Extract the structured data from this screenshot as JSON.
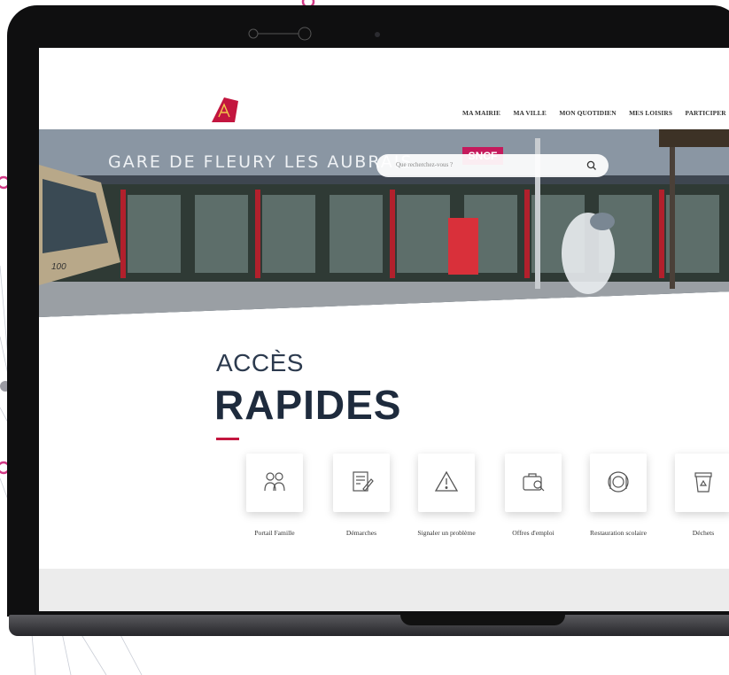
{
  "nav": {
    "items": [
      "MA MAIRIE",
      "MA VILLE",
      "MON QUOTIDIEN",
      "MES LOISIRS",
      "PARTICIPER"
    ]
  },
  "hero": {
    "station_sign": "GARE DE FLEURY LES AUBRAIS",
    "sncf_sign": "SNCF",
    "tram_number": "100"
  },
  "search": {
    "placeholder": "Que recherchez-vous ?"
  },
  "quick_access": {
    "title_top": "ACCÈS",
    "title_bottom": "RAPIDES",
    "items": [
      {
        "label": "Portail Famille",
        "icon": "family-icon"
      },
      {
        "label": "Démarches",
        "icon": "document-signature-icon"
      },
      {
        "label": "Signaler un problème",
        "icon": "warning-icon"
      },
      {
        "label": "Offres d'emploi",
        "icon": "job-briefcase-icon"
      },
      {
        "label": "Restauration scolaire",
        "icon": "plate-cutlery-icon"
      },
      {
        "label": "Déchets",
        "icon": "recycle-bin-icon"
      }
    ]
  },
  "colors": {
    "brand_red": "#c3163f",
    "title_navy": "#1e2b3d"
  }
}
